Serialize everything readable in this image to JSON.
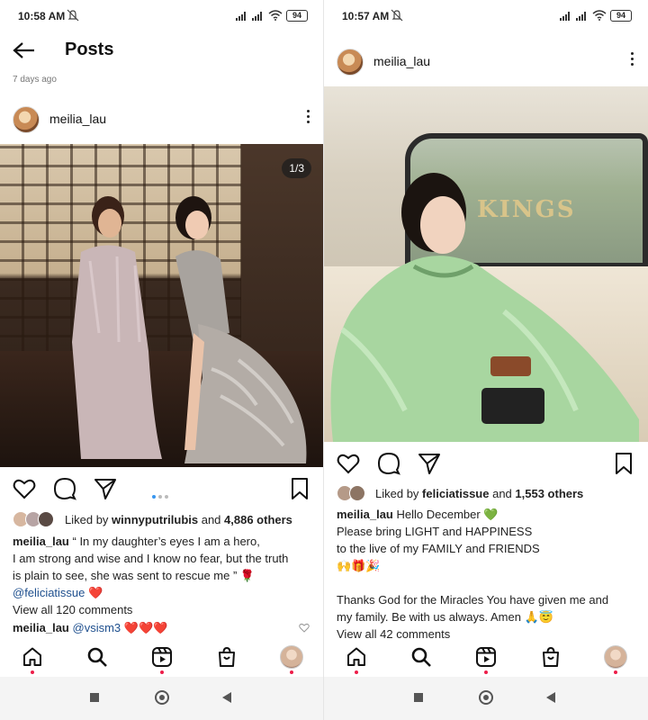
{
  "left": {
    "status": {
      "time": "10:58 AM",
      "battery": "94"
    },
    "header": {
      "title": "Posts"
    },
    "post_age": "7 days ago",
    "post": {
      "username": "meilia_lau",
      "image_counter": "1/3",
      "liked_prefix": "Liked by ",
      "liked_user": "winnyputrilubis",
      "liked_and": " and ",
      "liked_others": "4,886 others",
      "caption_user": "meilia_lau",
      "caption_lines": [
        "“ In my daughter’s eyes I am a hero,",
        "I am strong and wise and I know no fear, but the truth",
        "is plain to see, she was sent to rescue me ” 🌹"
      ],
      "mention": "@feliciatissue",
      "mention_suffix": " ❤️",
      "view_comments": "View all 120 comments",
      "comment_user": "meilia_lau",
      "comment_text": "@vsism3",
      "comment_emoji": " ❤️❤️❤️"
    }
  },
  "right": {
    "status": {
      "time": "10:57 AM",
      "battery": "94"
    },
    "post": {
      "username": "meilia_lau",
      "liked_prefix": "Liked by ",
      "liked_user": "feliciatissue",
      "liked_and": " and ",
      "liked_others": "1,553 others",
      "caption_user": "meilia_lau",
      "caption_first": " Hello December 💚",
      "caption_lines": [
        "Please bring LIGHT and HAPPINESS",
        "to the live of my FAMILY and FRIENDS",
        "🙌🎁🎉",
        "",
        "Thanks God for the Miracles You have given me and",
        "my family. Be with us always. Amen 🙏😇"
      ],
      "view_comments": "View all 42 comments",
      "sign_text": "KINGS"
    }
  },
  "nav": {
    "items": [
      "home-icon",
      "search-icon",
      "reels-icon",
      "shop-icon",
      "profile-avatar"
    ]
  },
  "colors": {
    "link": "#1e4f8e",
    "notification_dot": "#ed1d49",
    "carousel_active": "#3897f0",
    "heart_red": "#e0245e"
  }
}
